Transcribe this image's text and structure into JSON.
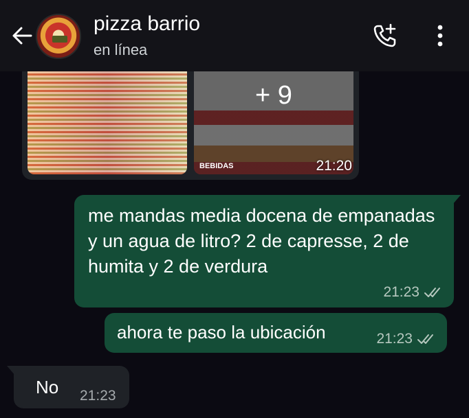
{
  "header": {
    "title": "pizza barrio",
    "status": "en línea",
    "icons": {
      "back": "arrow-left-icon",
      "call": "add-call-icon",
      "menu": "more-vertical-icon"
    }
  },
  "messages": [
    {
      "direction": "incoming",
      "type": "images",
      "extra_count_label": "+ 9",
      "thumb_label": "BEBIDAS",
      "time": "21:20"
    },
    {
      "direction": "outgoing",
      "text": "me mandas media docena de empanadas y un agua de litro? 2 de capresse, 2 de humita y 2 de verdura",
      "time": "21:23",
      "status_icon": "double-check-icon"
    },
    {
      "direction": "outgoing",
      "text": "ahora te paso la ubicación",
      "time": "21:23",
      "status_icon": "double-check-icon"
    },
    {
      "direction": "incoming",
      "text": "No",
      "time": "21:23"
    }
  ],
  "colors": {
    "background": "#0b0a12",
    "header": "#131318",
    "outgoing_bubble": "#144d37",
    "incoming_bubble": "#1f2227"
  }
}
